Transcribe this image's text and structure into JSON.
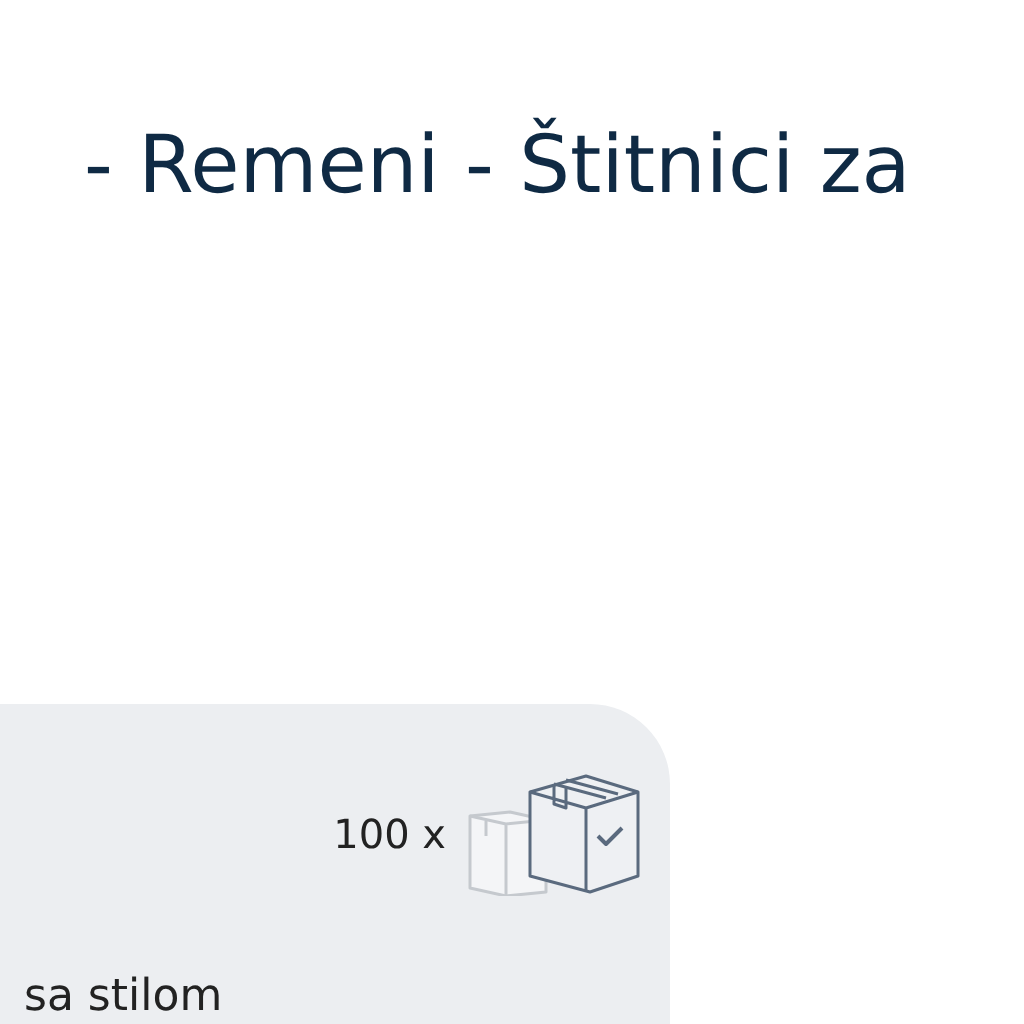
{
  "page_title": "- Remeni - Štitnici za",
  "product_card": {
    "quantity": "100 x",
    "description": "sa stilom"
  }
}
